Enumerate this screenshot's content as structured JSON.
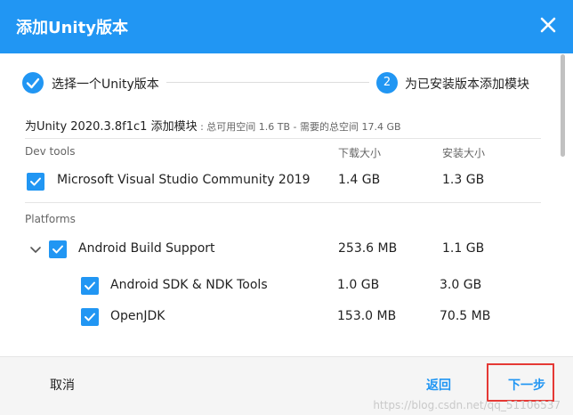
{
  "dialog": {
    "title": "添加Unity版本",
    "close_icon": "close-icon"
  },
  "steps": [
    {
      "label": "选择一个Unity版本",
      "state": "completed",
      "icon": "check-icon"
    },
    {
      "number": "2",
      "label": "为已安装版本添加模块",
      "state": "active"
    }
  ],
  "summary": {
    "main": "为Unity 2020.3.8f1c1 添加模块",
    "sub": " : 总可用空间 1.6 TB - 需要的总空间 17.4 GB"
  },
  "columns": {
    "download": "下载大小",
    "install": "安装大小"
  },
  "sections": [
    {
      "label": "Dev tools",
      "items": [
        {
          "label": "Microsoft Visual Studio Community 2019",
          "checked": true,
          "download": "1.4 GB",
          "install": "1.3 GB"
        }
      ]
    },
    {
      "label": "Platforms",
      "items": [
        {
          "label": "Android Build Support",
          "checked": true,
          "expanded": true,
          "download": "253.6 MB",
          "install": "1.1 GB",
          "children": [
            {
              "label": "Android SDK & NDK Tools",
              "checked": true,
              "download": "1.0 GB",
              "install": "3.0 GB"
            },
            {
              "label": "OpenJDK",
              "checked": true,
              "download": "153.0 MB",
              "install": "70.5 MB"
            }
          ]
        }
      ]
    }
  ],
  "footer": {
    "cancel": "取消",
    "back": "返回",
    "next": "下一步"
  },
  "watermark": "https://blog.csdn.net/qq_51106537",
  "colors": {
    "accent": "#2196f3",
    "highlight_border": "#e53935"
  }
}
